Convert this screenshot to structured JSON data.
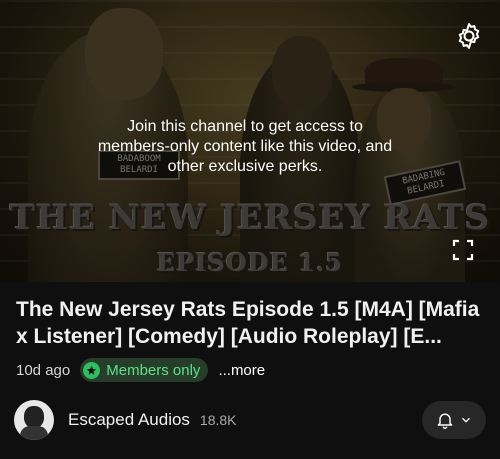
{
  "player": {
    "members_message": "Join this channel to get access to members-only content like this video, and other exclusive perks.",
    "artwork": {
      "title_line1": "THE NEW JERSEY RATS",
      "title_line2": "EPISODE 1.5",
      "sign_left_line1": "BADABOOM",
      "sign_left_line2": "BELARDI",
      "sign_right_line1": "BADABING",
      "sign_right_line2": "BELARDI"
    },
    "icons": {
      "settings": "gear-icon",
      "fullscreen": "fullscreen-icon"
    }
  },
  "video": {
    "title": "The New Jersey Rats Episode 1.5 [M4A] [Mafia x Listener] [Comedy] [Audio Roleplay] [E...",
    "age": "10d ago",
    "badge": "Members only",
    "more": "...more"
  },
  "channel": {
    "name": "Escaped Audios",
    "subscribers": "18.8K"
  },
  "colors": {
    "background": "#0f0f0f",
    "members_green": "#2bbf60",
    "members_badge_bg": "#263d2a"
  }
}
